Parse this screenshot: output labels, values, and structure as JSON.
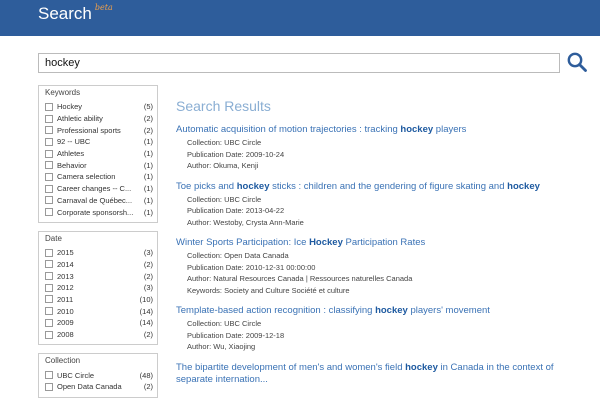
{
  "header": {
    "brand": "Search",
    "brand_sup": "beta"
  },
  "search": {
    "value": "hockey"
  },
  "facets": [
    {
      "title": "Keywords",
      "items": [
        {
          "label": "Hockey",
          "count": "(5)"
        },
        {
          "label": "Athletic ability",
          "count": "(2)"
        },
        {
          "label": "Professional sports",
          "count": "(2)"
        },
        {
          "label": "92 -- UBC",
          "count": "(1)"
        },
        {
          "label": "Athletes",
          "count": "(1)"
        },
        {
          "label": "Behavior",
          "count": "(1)"
        },
        {
          "label": "Camera selection",
          "count": "(1)"
        },
        {
          "label": "Career changes -- C...",
          "count": "(1)"
        },
        {
          "label": "Carnaval de Québec...",
          "count": "(1)"
        },
        {
          "label": "Corporate sponsorsh...",
          "count": "(1)"
        }
      ]
    },
    {
      "title": "Date",
      "items": [
        {
          "label": "2015",
          "count": "(3)"
        },
        {
          "label": "2014",
          "count": "(2)"
        },
        {
          "label": "2013",
          "count": "(2)"
        },
        {
          "label": "2012",
          "count": "(3)"
        },
        {
          "label": "2011",
          "count": "(10)"
        },
        {
          "label": "2010",
          "count": "(14)"
        },
        {
          "label": "2009",
          "count": "(14)"
        },
        {
          "label": "2008",
          "count": "(2)"
        }
      ]
    },
    {
      "title": "Collection",
      "items": [
        {
          "label": "UBC Circle",
          "count": "(48)"
        },
        {
          "label": "Open Data Canada",
          "count": "(2)"
        }
      ]
    }
  ],
  "results_title": "Search Results",
  "results": [
    {
      "title_parts": [
        "Automatic acquisition of motion trajectories : tracking ",
        "hockey",
        " players"
      ],
      "meta": [
        "Collection: UBC Circle",
        "Publication Date: 2009-10-24",
        "Author: Okuma, Kenji"
      ]
    },
    {
      "title_parts": [
        "Toe picks and ",
        "hockey",
        " sticks : children and the gendering of figure skating and ",
        "hockey"
      ],
      "meta": [
        "Collection: UBC Circle",
        "Publication Date: 2013-04-22",
        "Author: Westoby, Crysta Ann-Marie"
      ]
    },
    {
      "title_parts": [
        "Winter Sports Participation: Ice ",
        "Hockey",
        " Participation Rates"
      ],
      "meta": [
        "Collection: Open Data Canada",
        "Publication Date: 2010-12-31 00:00:00",
        "Author: Natural Resources Canada | Ressources naturelles Canada",
        "Keywords: Society and Culture Société et culture"
      ]
    },
    {
      "title_parts": [
        "Template-based action recognition : classifying ",
        "hockey",
        " players' movement"
      ],
      "meta": [
        "Collection: UBC Circle",
        "Publication Date: 2009-12-18",
        "Author: Wu, Xiaojing"
      ]
    },
    {
      "title_parts": [
        "The bipartite development of men's and women's field ",
        "hockey",
        " in Canada in the context of separate internation..."
      ],
      "meta": []
    }
  ],
  "colors": {
    "header": "#2e5d9b",
    "link": "#3a72b5",
    "results_title": "#8aaed3"
  },
  "icons": {
    "search": "search-icon"
  }
}
